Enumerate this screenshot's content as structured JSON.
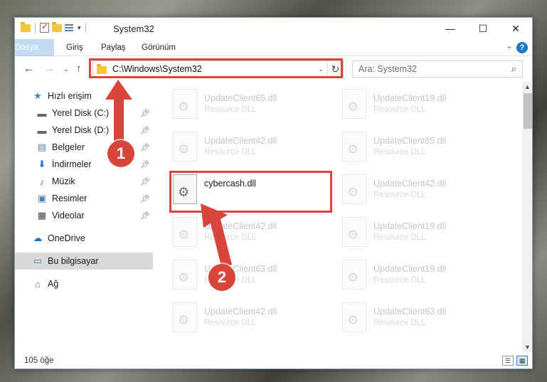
{
  "window": {
    "title": "System32",
    "controls": {
      "minimize": "—",
      "maximize": "☐",
      "close": "✕"
    }
  },
  "ribbon": {
    "tabs": [
      "Dosya",
      "Giriş",
      "Paylaş",
      "Görünüm"
    ],
    "accent": "#1979ca"
  },
  "navbar": {
    "address": "C:\\Windows\\System32",
    "search_placeholder": "Ara: System32"
  },
  "sidebar": {
    "items": [
      {
        "label": "Hızlı erişim",
        "icon": "star-icon",
        "pinned": false
      },
      {
        "label": "Yerel Disk (C:)",
        "icon": "drive-icon",
        "pinned": true
      },
      {
        "label": "Yerel Disk (D:)",
        "icon": "drive-icon",
        "pinned": true
      },
      {
        "label": "Belgeler",
        "icon": "documents-icon",
        "pinned": true
      },
      {
        "label": "İndirmeler",
        "icon": "downloads-icon",
        "pinned": true
      },
      {
        "label": "Müzik",
        "icon": "music-icon",
        "pinned": true
      },
      {
        "label": "Resimler",
        "icon": "pictures-icon",
        "pinned": true
      },
      {
        "label": "Videolar",
        "icon": "videos-icon",
        "pinned": true
      },
      {
        "label": "OneDrive",
        "icon": "cloud-icon",
        "pinned": false
      },
      {
        "label": "Bu bilgisayar",
        "icon": "computer-icon",
        "pinned": false,
        "selected": true
      },
      {
        "label": "Ağ",
        "icon": "network-icon",
        "pinned": false
      }
    ]
  },
  "files": [
    {
      "name": "UpdateClient65.dll",
      "type": "Resource DLL"
    },
    {
      "name": "UpdateClient19.dll",
      "type": "Resource DLL"
    },
    {
      "name": "UpdateClient42.dll",
      "type": "Resource DLL"
    },
    {
      "name": "UpdateClient65.dll",
      "type": "Resource DLL"
    },
    {
      "name": "cybercash.dll",
      "type": "",
      "selected": true
    },
    {
      "name": "UpdateClient42.dll",
      "type": "Resource DLL"
    },
    {
      "name": "UpdateClient42.dll",
      "type": "Resource DLL"
    },
    {
      "name": "UpdateClient19.dll",
      "type": "Resource DLL"
    },
    {
      "name": "UpdateClient63.dll",
      "type": "Resource DLL"
    },
    {
      "name": "UpdateClient19.dll",
      "type": "Resource DLL"
    },
    {
      "name": "UpdateClient42.dll",
      "type": "Resource DLL"
    },
    {
      "name": "UpdateClient63.dll",
      "type": "Resource DLL"
    }
  ],
  "status": {
    "count": "105 öğe"
  },
  "annotations": {
    "badge1": "1",
    "badge2": "2",
    "color": "#d9453b"
  }
}
